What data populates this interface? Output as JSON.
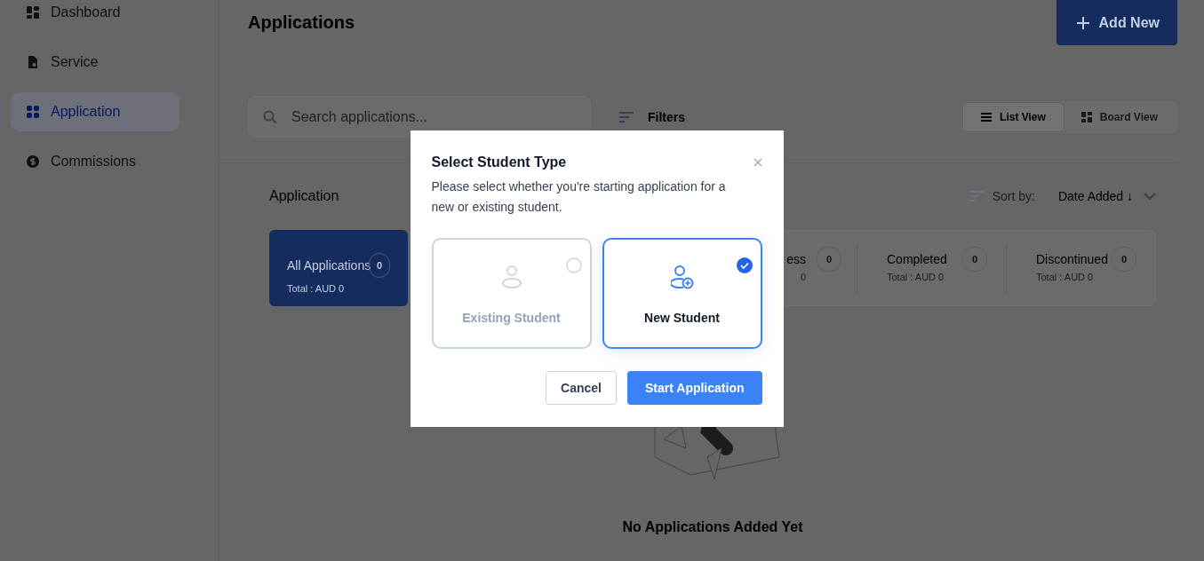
{
  "sidebar": {
    "items": [
      {
        "label": "Dashboard",
        "selected": false
      },
      {
        "label": "Service",
        "selected": false
      },
      {
        "label": "Application",
        "selected": true
      },
      {
        "label": "Commissions",
        "selected": false
      }
    ]
  },
  "header": {
    "title": "Applications",
    "add_button": "Add New"
  },
  "toolbar": {
    "search": {
      "placeholder": "Search applications..."
    },
    "filters": "Filters",
    "views": [
      {
        "label": "List View",
        "selected": true
      },
      {
        "label": "Board View",
        "selected": false
      }
    ]
  },
  "section": {
    "title": "Application",
    "sort_label": "Sort by:",
    "sort_value": "Date Added ↓"
  },
  "status_cards": [
    {
      "label": "All Applications",
      "count": "0",
      "total": "Total : AUD 0",
      "selected": true
    },
    {
      "label": "ess",
      "count": "0",
      "total": "0",
      "selected": false
    },
    {
      "label": "Completed",
      "count": "0",
      "total": "Total : AUD 0",
      "selected": false
    },
    {
      "label": "Discontinued",
      "count": "0",
      "total": "Total : AUD 0",
      "selected": false
    }
  ],
  "empty_state": {
    "message": "No Applications Added Yet"
  },
  "modal": {
    "title": "Select Student Type",
    "description": "Please select whether you're starting application for a new or existing student.",
    "options": [
      {
        "label": "Existing Student",
        "selected": false
      },
      {
        "label": "New Student",
        "selected": true
      }
    ],
    "cancel": "Cancel",
    "confirm": "Start Application"
  }
}
